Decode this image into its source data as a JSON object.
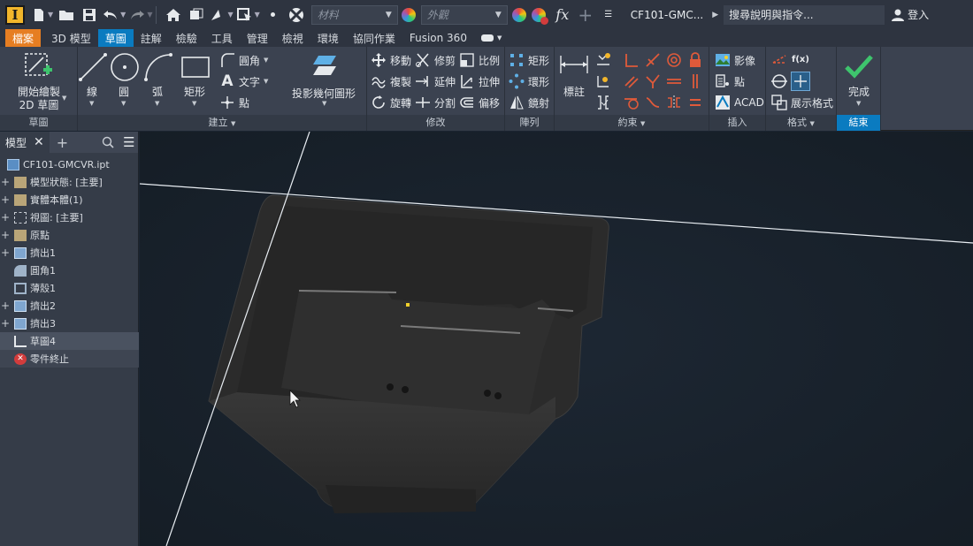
{
  "app": {
    "logo_letter": "I"
  },
  "qat": {
    "material_placeholder": "材料",
    "appearance_placeholder": "外觀",
    "fx_label": "fx",
    "document_title": "CF101-GMC...",
    "search_placeholder": "搜尋說明與指令...",
    "signin_label": "登入"
  },
  "tabs": [
    "檔案",
    "3D 模型",
    "草圖",
    "註解",
    "檢驗",
    "工具",
    "管理",
    "檢視",
    "環境",
    "協同作業",
    "Fusion 360"
  ],
  "ribbon": {
    "sketch_panel": {
      "title": "草圖",
      "start_line1": "開始繪製",
      "start_line2": "2D 草圖"
    },
    "create_panel": {
      "title": "建立",
      "line": "線",
      "circle": "圓",
      "arc": "弧",
      "rect": "矩形",
      "fillet": "圓角",
      "text": "文字",
      "point": "點"
    },
    "project_label": "投影幾何圖形",
    "modify_panel": {
      "title": "修改",
      "move": "移動",
      "trim": "修剪",
      "scale": "比例",
      "copy": "複製",
      "extend": "延伸",
      "stretch": "拉伸",
      "rotate": "旋轉",
      "split": "分割",
      "offset": "偏移"
    },
    "pattern_panel": {
      "title": "陣列",
      "rect": "矩形",
      "circ": "環形",
      "mirror": "鏡射"
    },
    "constrain_panel": {
      "title": "約束",
      "dimension": "標註"
    },
    "insert_panel": {
      "title": "插入",
      "image": "影像",
      "point": "點",
      "acad": "ACAD"
    },
    "format_panel": {
      "title": "格式",
      "show_format": "展示格式"
    },
    "exit_panel": {
      "title": "結束",
      "finish": "完成"
    }
  },
  "browser": {
    "tab_label": "模型",
    "items": [
      {
        "label": "CF101-GMCVR.ipt",
        "expander": ""
      },
      {
        "label": "模型狀態: [主要]",
        "expander": "+"
      },
      {
        "label": "實體本體(1)",
        "expander": "+"
      },
      {
        "label": "視圖: [主要]",
        "expander": "+"
      },
      {
        "label": "原點",
        "expander": "+"
      },
      {
        "label": "擠出1",
        "expander": "+"
      },
      {
        "label": "圓角1",
        "expander": ""
      },
      {
        "label": "薄殼1",
        "expander": ""
      },
      {
        "label": "擠出2",
        "expander": "+"
      },
      {
        "label": "擠出3",
        "expander": "+"
      },
      {
        "label": "草圖4",
        "expander": ""
      },
      {
        "label": "零件終止",
        "expander": ""
      }
    ]
  },
  "colors": {
    "accent": "#0a7bc0",
    "file_tab": "#e67e22",
    "finish_check": "#3ec46d"
  }
}
